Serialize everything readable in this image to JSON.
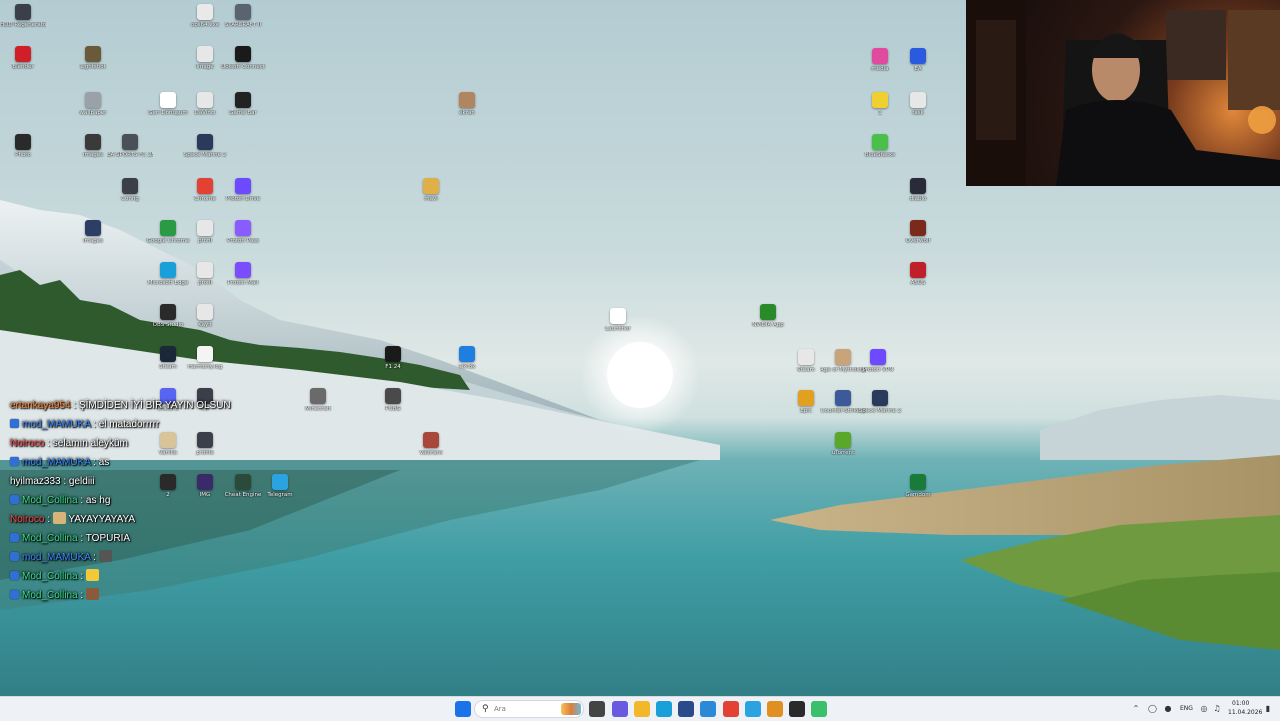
{
  "desktop_icons": [
    {
      "label": "HDD Regenerator / Utility Pro",
      "color": "#3a3f4a"
    },
    {
      "label": "obs64.exe",
      "color": "#e9e9e9"
    },
    {
      "label": "STARCRAFT II",
      "color": "#5a6470"
    },
    {
      "label": "Blender",
      "color": "#d11f2a"
    },
    {
      "label": "Lightshot",
      "color": "#6a5a3a"
    },
    {
      "label": "Image",
      "color": "#e7e7e7"
    },
    {
      "label": "Ubisoft Connect",
      "color": "#1a1a1a"
    },
    {
      "label": "wallpaper",
      "color": "#9aa1a8"
    },
    {
      "label": "Geri Dönüşüm",
      "color": "#ffffff"
    },
    {
      "label": "DaVinci",
      "color": "#e7e7e7"
    },
    {
      "label": "Game Bar",
      "color": "#222222"
    },
    {
      "label": "ekran",
      "color": "#b08560"
    },
    {
      "label": "Photo",
      "color": "#2a2a2a"
    },
    {
      "label": "images",
      "color": "#3a3a3a"
    },
    {
      "label": "EA SPORTS FC 25",
      "color": "#4a4f58"
    },
    {
      "label": "Space Marine 2",
      "color": "#2a3a5a"
    },
    {
      "label": "Config",
      "color": "#3a3f4a"
    },
    {
      "label": "Chrome",
      "color": "#e34133"
    },
    {
      "label": "Proton Drive",
      "color": "#6d4aff"
    },
    {
      "label": "mavi",
      "color": "#e0b048"
    },
    {
      "label": "images",
      "color": "#2c3e66"
    },
    {
      "label": "Google Chrome",
      "color": "#2b9a45"
    },
    {
      "label": "profil",
      "color": "#e7e7e7"
    },
    {
      "label": "Proton Pass",
      "color": "#8a5cff"
    },
    {
      "label": "Microsoft Edge",
      "color": "#1aa0d8"
    },
    {
      "label": "profil",
      "color": "#e7e7e7"
    },
    {
      "label": "Proton Mail",
      "color": "#7a4dff"
    },
    {
      "label": "OBS Studio",
      "color": "#2a2a2a"
    },
    {
      "label": "Kayıt",
      "color": "#e7e7e7"
    },
    {
      "label": "Steam",
      "color": "#1b2838"
    },
    {
      "label": "Harmony.log",
      "color": "#f4f4f4"
    },
    {
      "label": "F1 24",
      "color": "#1a1a1a"
    },
    {
      "label": "TikTok",
      "color": "#1f7fe0"
    },
    {
      "label": "Discord",
      "color": "#5865f2"
    },
    {
      "label": "Kit",
      "color": "#3a3f4a"
    },
    {
      "label": "Minecraft",
      "color": "#6a6a6a"
    },
    {
      "label": "PUBG",
      "color": "#4a4a4a"
    },
    {
      "label": "Vanilla",
      "color": "#d9c39a"
    },
    {
      "label": "profile",
      "color": "#3a3f4a"
    },
    {
      "label": "Valorant",
      "color": "#a8473a"
    },
    {
      "label": "2",
      "color": "#2a2a2a"
    },
    {
      "label": "IMG",
      "color": "#3a2a6a"
    },
    {
      "label": "Cheat Engine",
      "color": "#2a4a3a"
    },
    {
      "label": "Telegram",
      "color": "#2aa3e0"
    },
    {
      "label": "Launcher",
      "color": "#ffffff"
    },
    {
      "label": "NVIDIA App",
      "color": "#2a8a2a"
    },
    {
      "label": "Steam",
      "color": "#e7e7e7"
    },
    {
      "label": "Age of Mythology",
      "color": "#c9a37a"
    },
    {
      "label": "Proton VPN",
      "color": "#6d4aff"
    },
    {
      "label": "Epic",
      "color": "#e0a020"
    },
    {
      "label": "Counter-Strike 2",
      "color": "#3a5a9a"
    },
    {
      "label": "Space Marine 2",
      "color": "#2a3a5a"
    },
    {
      "label": "uTorrent",
      "color": "#5aa82a"
    },
    {
      "label": "Gamdom",
      "color": "#1a7a3a"
    },
    {
      "label": "media",
      "color": "#e24aa0"
    },
    {
      "label": "EA",
      "color": "#2a5ae0"
    },
    {
      "label": "1",
      "color": "#f0d030"
    },
    {
      "label": "task",
      "color": "#e7e7e7"
    },
    {
      "label": "BlueStacks",
      "color": "#4ac04a"
    },
    {
      "label": "diablo",
      "color": "#2a2a3a"
    },
    {
      "label": "Overwolf",
      "color": "#7a2a1a"
    },
    {
      "label": "ASUS",
      "color": "#c0202a"
    }
  ],
  "chat": [
    {
      "user": "ertankaya954",
      "user_color": "#ff8a3a",
      "badge": false,
      "message": ": ŞİMDİDEN İYİ BİR YAYIN OLSUN",
      "emote": ""
    },
    {
      "user": "mod_MAMUKA",
      "user_color": "#3a8aff",
      "badge": true,
      "message": ": el matadorrrrr",
      "emote": ""
    },
    {
      "user": "Noiroco",
      "user_color": "#ff4a4a",
      "badge": false,
      "message": ": selamın aleyküm",
      "emote": ""
    },
    {
      "user": "mod_MAMUKA",
      "user_color": "#3a8aff",
      "badge": true,
      "message": ": as",
      "emote": ""
    },
    {
      "user": "hyilmaz333",
      "user_color": "#ffffff",
      "badge": false,
      "message": ": geldiii",
      "emote": ""
    },
    {
      "user": "Mod_Collina",
      "user_color": "#3adf8a",
      "badge": true,
      "message": ": as hg",
      "emote": ""
    },
    {
      "user": "Noiroco",
      "user_color": "#ff4a4a",
      "badge": false,
      "message": ":",
      "emote": "#d9b47a",
      "after": "YAYAYYAYAYA"
    },
    {
      "user": "Mod_Collina",
      "user_color": "#3adf8a",
      "badge": true,
      "message": ": TOPURIA",
      "emote": ""
    },
    {
      "user": "mod_MAMUKA",
      "user_color": "#3a8aff",
      "badge": true,
      "message": ":",
      "emote": "#555555"
    },
    {
      "user": "Mod_Collina",
      "user_color": "#3adf8a",
      "badge": true,
      "message": ":",
      "emote": "#f3c93a"
    },
    {
      "user": "Mod_Collina",
      "user_color": "#3adf8a",
      "badge": true,
      "message": ":",
      "emote": "#8a5a3a"
    }
  ],
  "taskbar": {
    "search_placeholder": "Ara",
    "language": "ENG",
    "time": "01:00",
    "date": "11.04.2026"
  },
  "taskbar_apps": [
    {
      "name": "start-button",
      "color": "#1a73e8"
    },
    {
      "name": "task-view-button",
      "color": "#444444"
    },
    {
      "name": "copilot-button",
      "color": "#6a5ae0"
    },
    {
      "name": "file-explorer-button",
      "color": "#f2b82a"
    },
    {
      "name": "edge-button",
      "color": "#1aa0d8"
    },
    {
      "name": "store-button",
      "color": "#2a4a8a"
    },
    {
      "name": "vscode-button",
      "color": "#2a8ad8"
    },
    {
      "name": "chrome-button",
      "color": "#e34133"
    },
    {
      "name": "telegram-button",
      "color": "#2aa3e0"
    },
    {
      "name": "winamp-button",
      "color": "#e09020"
    },
    {
      "name": "obs-button",
      "color": "#2a2a2a"
    },
    {
      "name": "game-button",
      "color": "#3ac06a"
    }
  ]
}
